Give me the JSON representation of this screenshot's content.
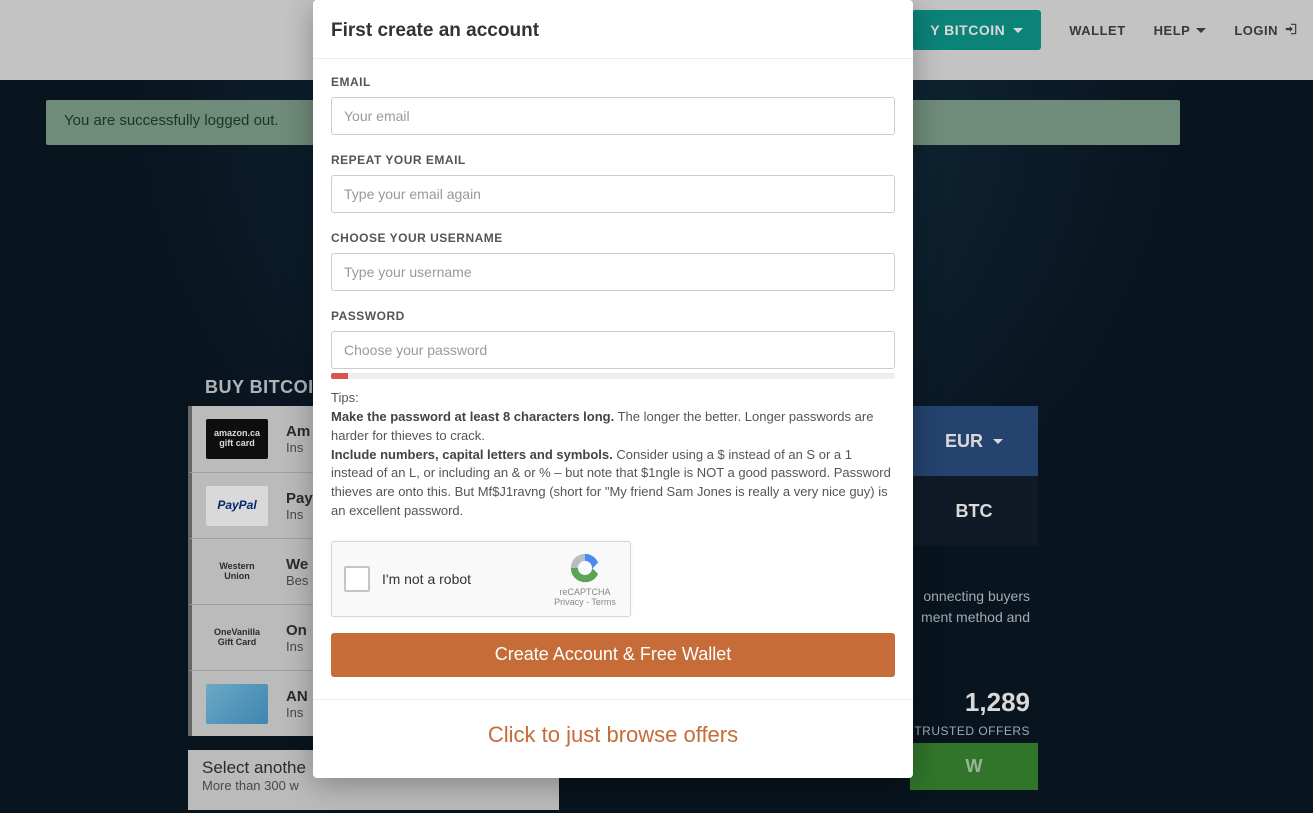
{
  "nav": {
    "buy_label": "Y BITCOIN",
    "wallet": "WALLET",
    "help": "HELP",
    "login": "LOGIN"
  },
  "alert": {
    "text": "You are successfully logged out."
  },
  "bg": {
    "heading": "BUY BITCOIN",
    "pay_methods": [
      {
        "img": "amazon.ca gift card",
        "title": "Am",
        "sub": "Ins",
        "dark": true
      },
      {
        "img": "PayPal",
        "title": "Pay",
        "sub": "Ins",
        "dark": false
      },
      {
        "img": "Western Union",
        "title": "We",
        "sub": "Bes",
        "dark": false
      },
      {
        "img": "OneVanilla Gift Card",
        "title": "On",
        "sub": "Ins",
        "dark": false
      },
      {
        "img": "",
        "title": "AN",
        "sub": "Ins",
        "dark": false
      }
    ],
    "select_other_title": "Select anothe",
    "select_other_sub": "More than 300 w",
    "currency_top": "EUR",
    "currency_bottom": "BTC",
    "right_desc_l1": "onnecting buyers",
    "right_desc_l2": "ment method and",
    "trusted_n": "1,289",
    "trusted_t": "TRUSTED OFFERS",
    "green_btn": "W"
  },
  "modal": {
    "title": "First create an account",
    "email_label": "EMAIL",
    "email_placeholder": "Your email",
    "repeat_label": "REPEAT YOUR EMAIL",
    "repeat_placeholder": "Type your email again",
    "username_label": "CHOOSE YOUR USERNAME",
    "username_placeholder": "Type your username",
    "password_label": "PASSWORD",
    "password_placeholder": "Choose your password",
    "tips_head": "Tips:",
    "tips_1_bold": "Make the password at least 8 characters long.",
    "tips_1_rest": " The longer the better. Longer passwords are harder for thieves to crack.",
    "tips_2_bold": "Include numbers, capital letters and symbols.",
    "tips_2_rest": " Consider using a $ instead of an S or a 1 instead of an L, or including an & or % – but note that $1ngle is NOT a good password. Password thieves are onto this. But Mf$J1ravng (short for \"My friend Sam Jones is really a very nice guy) is an excellent password.",
    "recaptcha_label": "I'm not a robot",
    "recaptcha_brand": "reCAPTCHA",
    "recaptcha_links": "Privacy - Terms",
    "create_btn": "Create Account & Free Wallet",
    "browse_link": "Click to just browse offers"
  }
}
